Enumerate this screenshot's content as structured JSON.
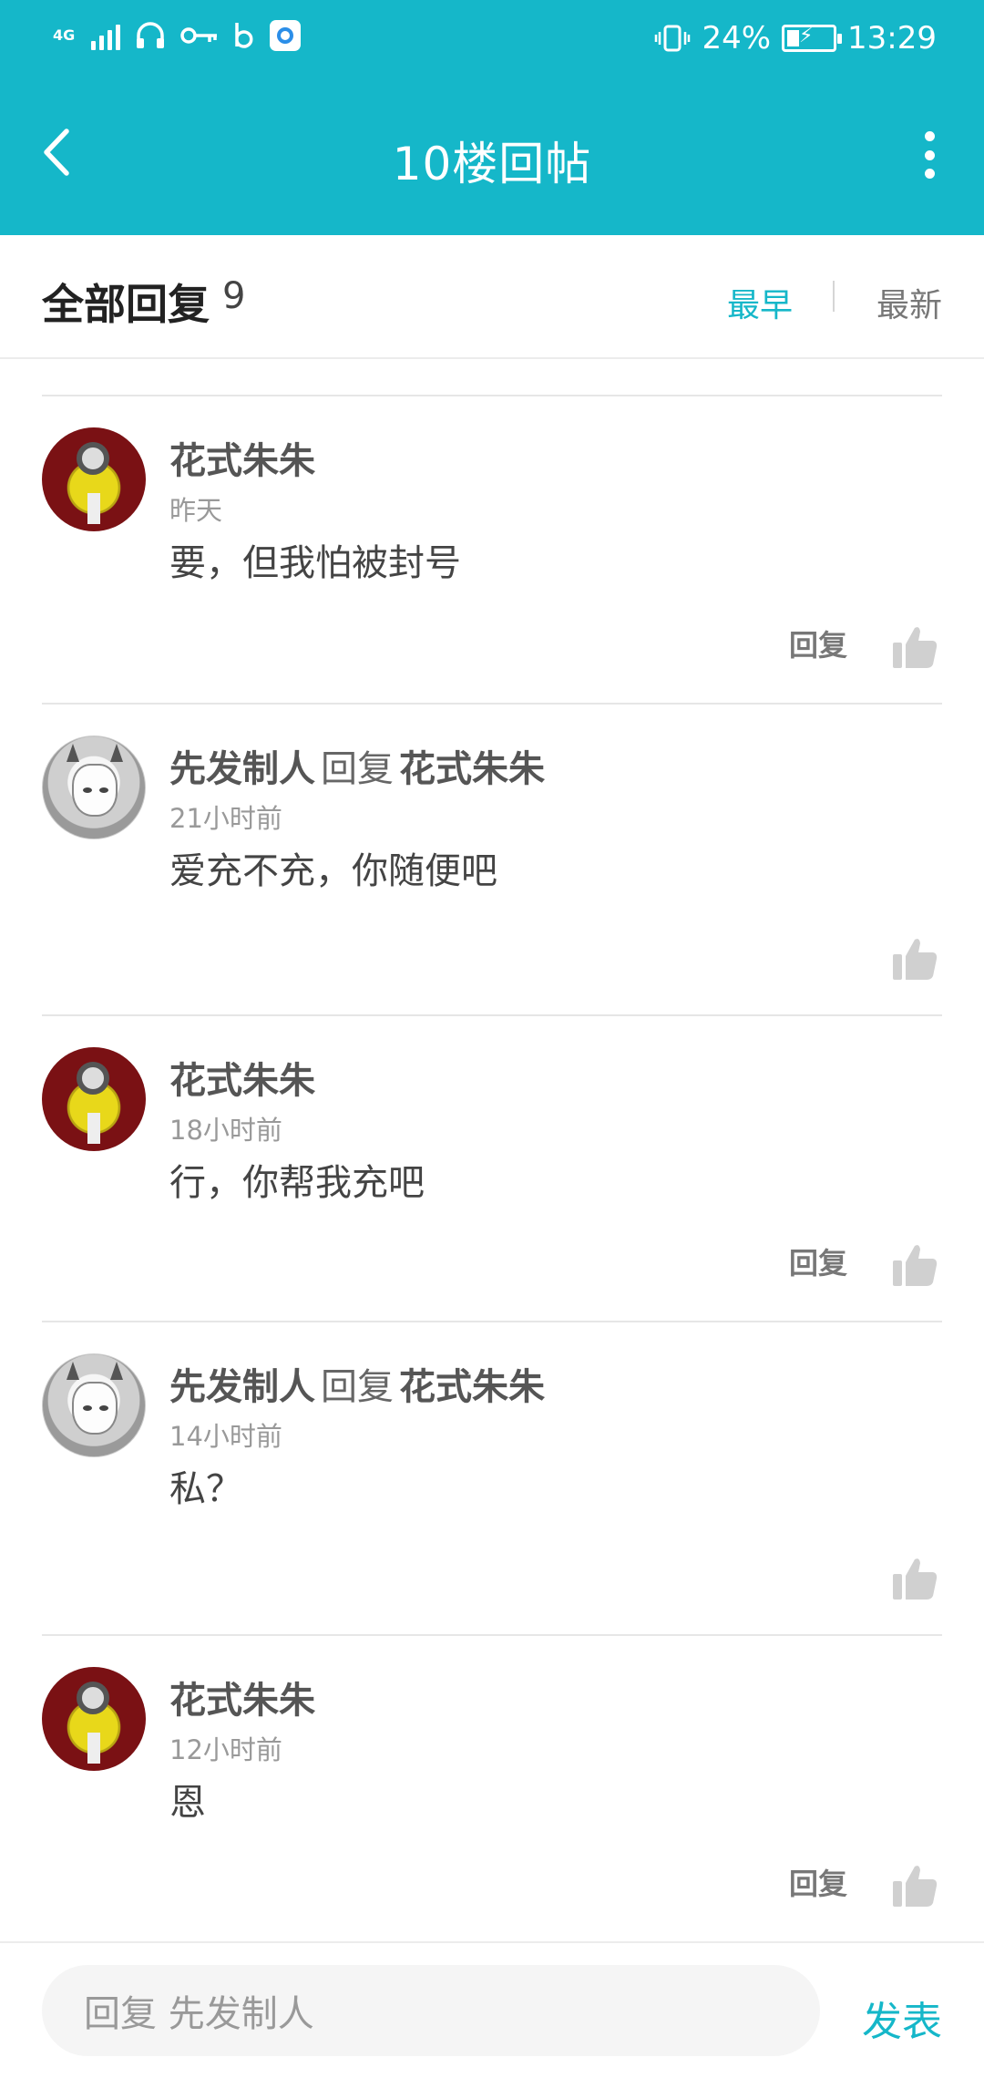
{
  "status_bar": {
    "network": "4G",
    "battery": "24%",
    "time": "13:29"
  },
  "header": {
    "title": "10楼回帖",
    "back_icon": "chevron-left-icon",
    "menu_icon": "more-vertical-icon"
  },
  "replies_header": {
    "label": "全部回复",
    "count": "9",
    "sort_early": "最早",
    "sort_new": "最新",
    "active_sort": "最早"
  },
  "replies": [
    {
      "author": "花式朱朱",
      "reply_word": "",
      "reply_to": "",
      "time": "昨天",
      "content": "要，但我怕被封号",
      "reply_label": "回复",
      "avatar": "minion"
    },
    {
      "author": "先发制人",
      "reply_word": "回复",
      "reply_to": "花式朱朱",
      "time": "21小时前",
      "content": "爱充不充，你随便吧",
      "reply_label": "",
      "avatar": "anime"
    },
    {
      "author": "花式朱朱",
      "reply_word": "",
      "reply_to": "",
      "time": "18小时前",
      "content": "行，你帮我充吧",
      "reply_label": "回复",
      "avatar": "minion"
    },
    {
      "author": "先发制人",
      "reply_word": "回复",
      "reply_to": "花式朱朱",
      "time": "14小时前",
      "content": "私？",
      "reply_label": "",
      "avatar": "anime"
    },
    {
      "author": "花式朱朱",
      "reply_word": "",
      "reply_to": "",
      "time": "12小时前",
      "content": "恩",
      "reply_label": "回复",
      "avatar": "minion"
    }
  ],
  "composer": {
    "placeholder": "回复 先发制人",
    "send_label": "发表"
  },
  "colors": {
    "accent": "#15b7c9",
    "text_primary": "#555555",
    "text_secondary": "#999999"
  }
}
